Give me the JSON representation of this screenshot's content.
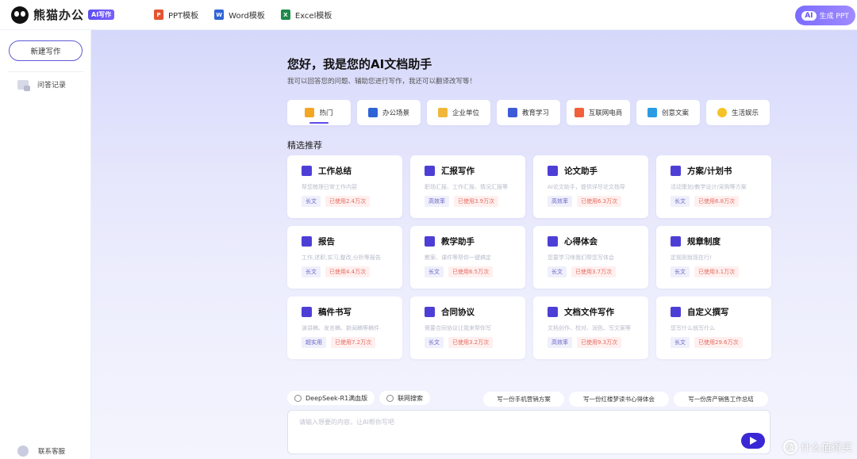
{
  "app": {
    "logo_text": "熊猫办公",
    "logo_badge": "AI写作"
  },
  "nav": [
    {
      "label": "PPT模板",
      "icon": "ppt-file-icon",
      "glyph": "P"
    },
    {
      "label": "Word模板",
      "icon": "word-file-icon",
      "glyph": "W"
    },
    {
      "label": "Excel模板",
      "icon": "excel-file-icon",
      "glyph": "X"
    }
  ],
  "header": {
    "gen_ai": "AI",
    "gen_label": "生成 PPT"
  },
  "sidebar": {
    "new_button": "新建写作",
    "history": "问答记录",
    "contact": "联系客服"
  },
  "main": {
    "title": "您好，我是您的AI文档助手",
    "subtitle": "我可以回答您的问题、辅助您进行写作，我还可以翻译改写等！",
    "section_title": "精选推荐",
    "categories": [
      {
        "label": "热门",
        "icon": "trophy-icon",
        "color": "#f3a623"
      },
      {
        "label": "办公场景",
        "icon": "word-doc-icon",
        "color": "#2f64d6"
      },
      {
        "label": "企业单位",
        "icon": "building-icon",
        "color": "#f0b73a"
      },
      {
        "label": "教育学习",
        "icon": "books-icon",
        "color": "#3d5bd8"
      },
      {
        "label": "互联网电商",
        "icon": "shopping-bag-icon",
        "color": "#f0613b"
      },
      {
        "label": "创意文案",
        "icon": "text-t-icon",
        "color": "#2b9be3"
      },
      {
        "label": "生活娱乐",
        "icon": "pacman-icon",
        "color": "#f5c227"
      }
    ],
    "cards": [
      {
        "title": "工作总结",
        "desc": "帮您梳理日常工作内容",
        "tag1": "长文",
        "tag2": "已使用2.4万次",
        "icon": "pen-doc-icon"
      },
      {
        "title": "汇报写作",
        "desc": "职场汇报、工作汇报、情况汇报等",
        "tag1": "高效率",
        "tag2": "已使用3.9万次",
        "icon": "report-doc-icon"
      },
      {
        "title": "论文助手",
        "desc": "AI论文助手，提供详尽论文指导",
        "tag1": "高效率",
        "tag2": "已使用6.3万次",
        "icon": "book-bookmark-icon"
      },
      {
        "title": "方案/计划书",
        "desc": "活动策划/教学设计/采购等方案",
        "tag1": "长文",
        "tag2": "已使用6.8万次",
        "icon": "check-shield-icon"
      },
      {
        "title": "报告",
        "desc": "工作,述职,实习,整改,分析等报告",
        "tag1": "长文",
        "tag2": "已使用4.4万次",
        "icon": "gear-doc-icon"
      },
      {
        "title": "教学助手",
        "desc": "教案、课件等帮你一键搞定",
        "tag1": "长文",
        "tag2": "已使用6.5万次",
        "icon": "teacher-icon"
      },
      {
        "title": "心得体会",
        "desc": "您要学习啥我们帮您写体会",
        "tag1": "长文",
        "tag2": "已使用3.7万次",
        "icon": "clipboard-check-icon"
      },
      {
        "title": "规章制度",
        "desc": "定规则就现在行!",
        "tag1": "长文",
        "tag2": "已使用3.1万次",
        "icon": "rules-doc-icon"
      },
      {
        "title": "稿件书写",
        "desc": "演讲稿、发言稿、新闻稿等稿件",
        "tag1": "超实用",
        "tag2": "已使用7.2万次",
        "icon": "chart-line-icon"
      },
      {
        "title": "合同协议",
        "desc": "需要合同协议让我来帮你写",
        "tag1": "长文",
        "tag2": "已使用3.2万次",
        "icon": "contract-icon"
      },
      {
        "title": "文档文件写作",
        "desc": "文档创作、校对、润色、写文案等",
        "tag1": "高效率",
        "tag2": "已使用9.3万次",
        "icon": "document-icon"
      },
      {
        "title": "自定义撰写",
        "desc": "您写什么就写什么",
        "tag1": "长文",
        "tag2": "已使用29.6万次",
        "icon": "custom-chart-icon"
      }
    ],
    "chips": [
      {
        "label": "DeepSeek-R1满血版",
        "icon": "deepseek-icon"
      },
      {
        "label": "联网搜索",
        "icon": "globe-icon"
      }
    ],
    "suggestions": [
      "写一份手机营销方案",
      "写一份红楼梦读书心得体会",
      "写一份房产销售工作总结"
    ],
    "input_placeholder": "请输入想要的内容，让AI帮你写吧"
  },
  "watermark": {
    "glyph": "值",
    "text": "什么值得买"
  }
}
